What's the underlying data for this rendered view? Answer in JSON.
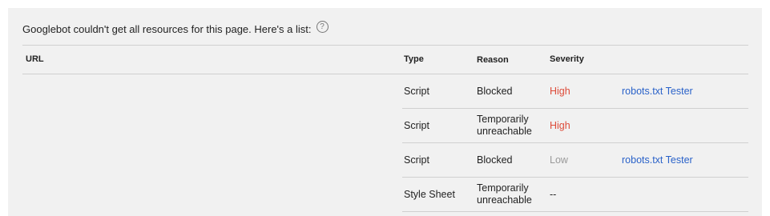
{
  "heading": "Googlebot couldn't get all resources for this page. Here's a list:",
  "help_icon": "?",
  "columns": {
    "url": "URL",
    "type": "Type",
    "reason": "Reason",
    "severity": "Severity"
  },
  "rows": [
    {
      "url": "",
      "type": "Script",
      "reason": "Blocked",
      "severity": "High",
      "severity_level": "high",
      "action": "robots.txt Tester"
    },
    {
      "url": "",
      "type": "Script",
      "reason": "Temporarily unreachable",
      "severity": "High",
      "severity_level": "high",
      "action": ""
    },
    {
      "url": "",
      "type": "Script",
      "reason": "Blocked",
      "severity": "Low",
      "severity_level": "low",
      "action": "robots.txt Tester"
    },
    {
      "url": "",
      "type": "Style Sheet",
      "reason": "Temporarily unreachable",
      "severity": "--",
      "severity_level": "none",
      "action": ""
    }
  ],
  "colors": {
    "high": "#dd4b39",
    "low": "#999999",
    "link": "#2a62c9",
    "panel": "#f1f1f1"
  }
}
